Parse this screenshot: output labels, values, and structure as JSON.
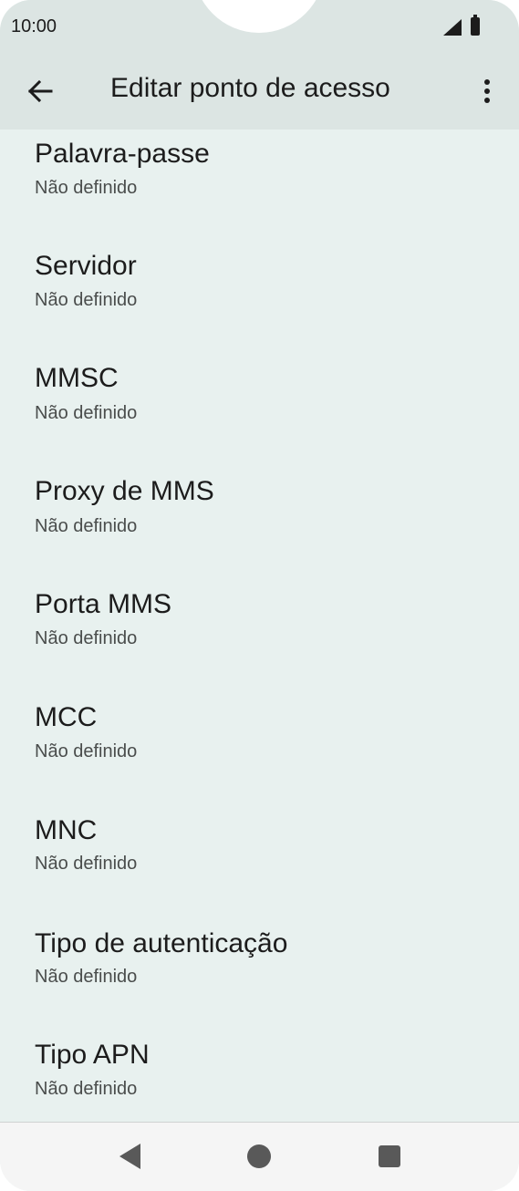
{
  "status_bar": {
    "time": "10:00"
  },
  "app_bar": {
    "title": "Editar ponto de acesso"
  },
  "items": [
    {
      "title": "Palavra-passe",
      "value": "Não definido"
    },
    {
      "title": "Servidor",
      "value": "Não definido"
    },
    {
      "title": "MMSC",
      "value": "Não definido"
    },
    {
      "title": "Proxy de MMS",
      "value": "Não definido"
    },
    {
      "title": "Porta MMS",
      "value": "Não definido"
    },
    {
      "title": "MCC",
      "value": "Não definido"
    },
    {
      "title": "MNC",
      "value": "Não definido"
    },
    {
      "title": "Tipo de autenticação",
      "value": "Não definido"
    },
    {
      "title": "Tipo APN",
      "value": "Não definido"
    }
  ],
  "icons": {
    "back": "arrow-left-icon",
    "more": "more-vert-icon",
    "signal": "signal-icon",
    "battery": "battery-icon",
    "nav_back": "nav-back-icon",
    "nav_home": "nav-home-icon",
    "nav_recent": "nav-recent-icon"
  },
  "colors": {
    "background": "#e8f1ef",
    "top_bar": "#dce5e3",
    "nav_bar": "#f5f5f5"
  }
}
